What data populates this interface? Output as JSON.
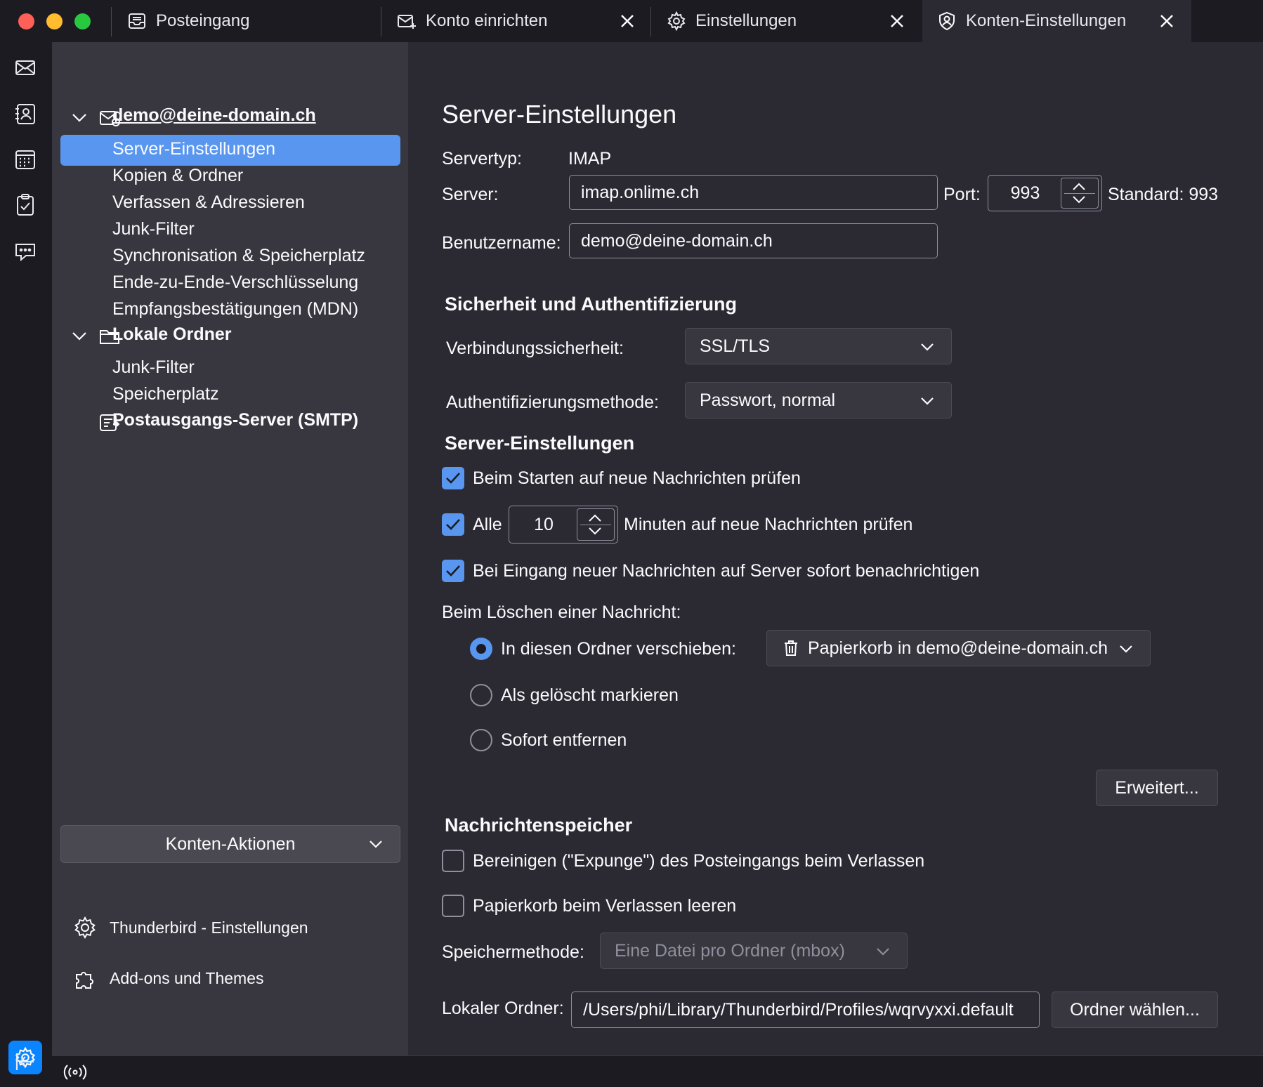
{
  "tabs": [
    {
      "label": "Posteingang",
      "icon": "inbox-icon"
    },
    {
      "label": "Konto einrichten",
      "icon": "mail-setup-icon"
    },
    {
      "label": "Einstellungen",
      "icon": "gear-icon"
    },
    {
      "label": "Konten-Einstellungen",
      "icon": "account-settings-icon"
    }
  ],
  "spaces": [
    "mail-icon",
    "address-book-icon",
    "calendar-icon",
    "tasks-icon",
    "chat-icon",
    "gear-icon",
    "collapse-icon"
  ],
  "sidebar": {
    "account": "demo@deine-domain.ch",
    "account_items": [
      "Server-Einstellungen",
      "Kopien & Ordner",
      "Verfassen & Adressieren",
      "Junk-Filter",
      "Synchronisation & Speicherplatz",
      "Ende-zu-Ende-Verschlüsselung",
      "Empfangsbestätigungen (MDN)"
    ],
    "local_folders": "Lokale Ordner",
    "local_items": [
      "Junk-Filter",
      "Speicherplatz"
    ],
    "smtp": "Postausgangs-Server (SMTP)",
    "account_actions": "Konten-Aktionen",
    "thunderbird_settings": "Thunderbird - Einstellungen",
    "addons": "Add-ons und Themes"
  },
  "main": {
    "title": "Server-Einstellungen",
    "servertype_label": "Servertyp:",
    "servertype_value": "IMAP",
    "server_label": "Server:",
    "server_value": "imap.onlime.ch",
    "port_label": "Port:",
    "port_value": "993",
    "standard_label": "Standard: 993",
    "username_label": "Benutzername:",
    "username_value": "demo@deine-domain.ch",
    "security_heading": "Sicherheit und Authentifizierung",
    "conn_security_label": "Verbindungssicherheit:",
    "conn_security_value": "SSL/TLS",
    "auth_label": "Authentifizierungsmethode:",
    "auth_value": "Passwort, normal",
    "server_settings_heading": "Server-Einstellungen",
    "check_on_start": "Beim Starten auf neue Nachrichten prüfen",
    "check_every": "Alle",
    "check_minutes_value": "10",
    "check_minutes_label": "Minuten auf neue Nachrichten prüfen",
    "notify_label": "Bei Eingang neuer Nachrichten auf Server sofort benachrichtigen",
    "delete_heading": "Beim Löschen einer Nachricht:",
    "delete_move": "In diesen Ordner verschieben:",
    "delete_folder": "Papierkorb in demo@deine-domain.ch",
    "delete_mark": "Als gelöscht markieren",
    "delete_remove": "Sofort entfernen",
    "advanced_button": "Erweitert...",
    "storage_heading": "Nachrichtenspeicher",
    "expunge_label": "Bereinigen (\"Expunge\") des Posteingangs beim Verlassen",
    "empty_trash_label": "Papierkorb beim Verlassen leeren",
    "storage_method_label": "Speichermethode:",
    "storage_method_value": "Eine Datei pro Ordner (mbox)",
    "local_folder_label": "Lokaler Ordner:",
    "local_folder_value": "/Users/phi/Library/Thunderbird/Profiles/wqrvyxxi.default",
    "choose_folder_button": "Ordner wählen..."
  },
  "colors": {
    "accent": "#5896f0",
    "settings_button": "#0a84ff"
  }
}
